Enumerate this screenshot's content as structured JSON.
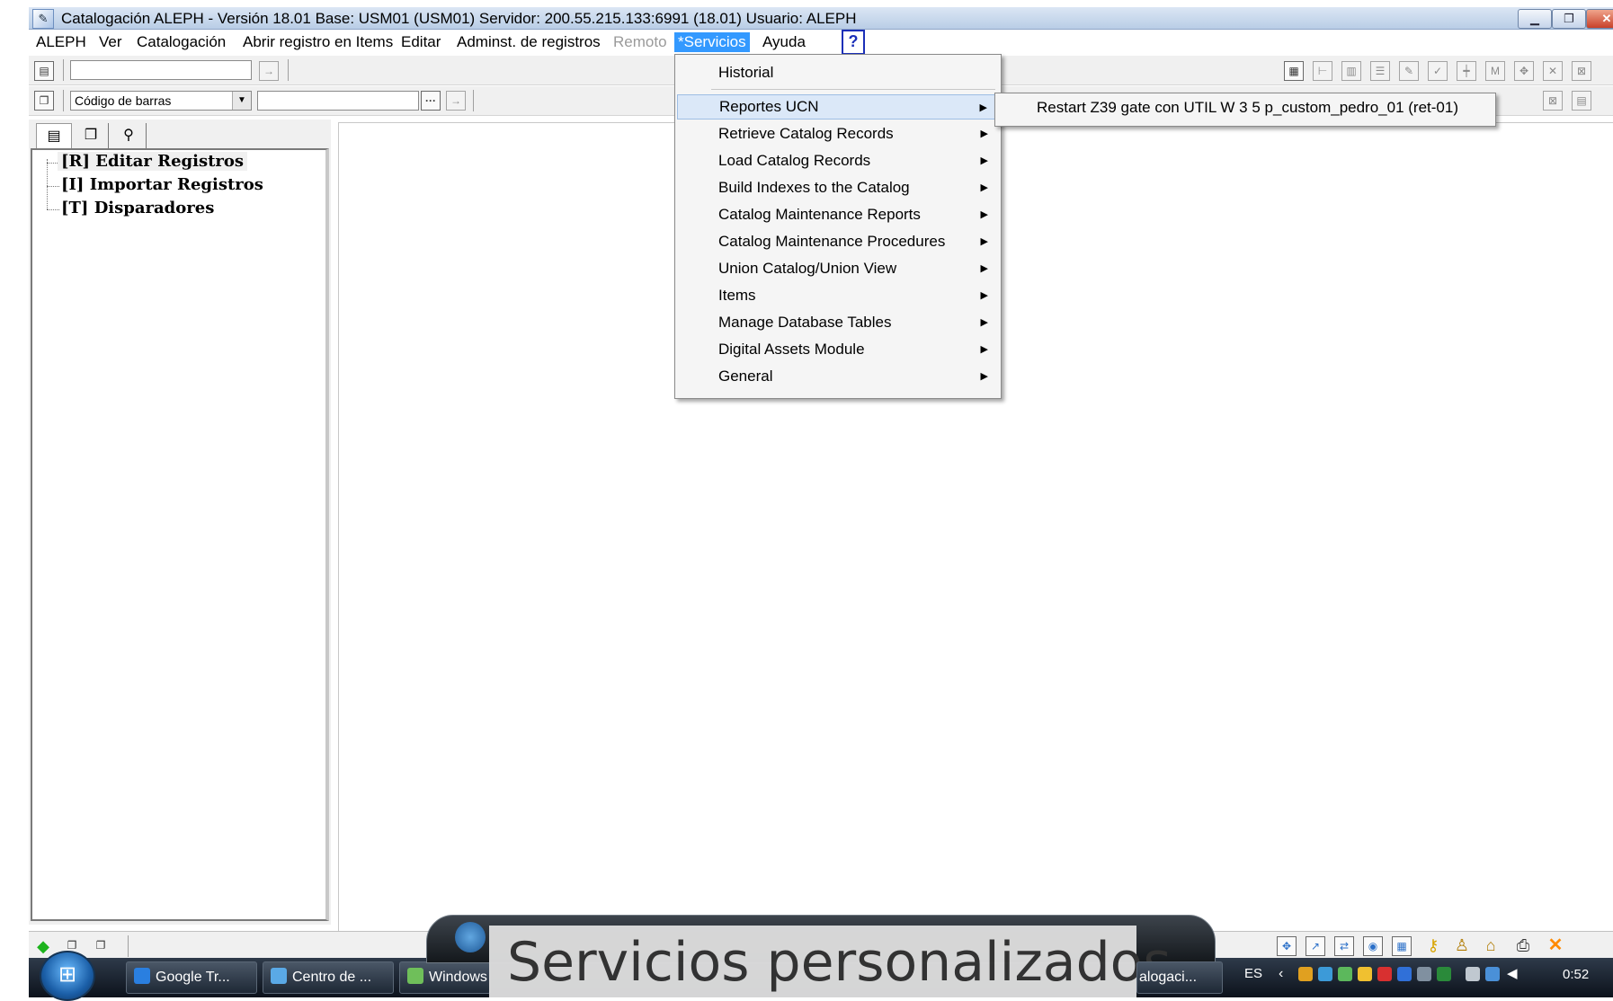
{
  "window": {
    "title": "Catalogación ALEPH - Versión 18.01  Base:  USM01 (USM01)  Servidor:  200.55.215.133:6991 (18.01)  Usuario:  ALEPH"
  },
  "menubar": {
    "items": [
      "ALEPH",
      "Ver",
      "Catalogación",
      "Abrir registro en Items",
      "Editar",
      "Adminst. de registros",
      "Remoto",
      "*Servicios",
      "Ayuda"
    ],
    "help_icon": "?",
    "active_item": "*Servicios",
    "disabled_item": "Remoto"
  },
  "toolbar2": {
    "select_value": "Código de barras",
    "browse_button": "···"
  },
  "tree": {
    "items": [
      "[R] Editar Registros",
      "[I] Importar Registros",
      "[T] Disparadores"
    ]
  },
  "services_menu": {
    "first_item": "Historial",
    "items": [
      "Reportes UCN",
      "Retrieve Catalog Records",
      "Load Catalog Records",
      "Build Indexes to the Catalog",
      "Catalog Maintenance Reports",
      "Catalog Maintenance Procedures",
      "Union Catalog/Union View",
      "Items",
      "Manage Database Tables",
      "Digital Assets Module",
      "General"
    ],
    "highlighted": "Reportes UCN"
  },
  "submenu": {
    "items": [
      "Restart Z39 gate con UTIL W 3 5 p_custom_pedro_01 (ret-01)"
    ]
  },
  "taskbar": {
    "buttons": [
      "Google Tr...",
      "Centro de ...",
      "Windows",
      "alogaci..."
    ],
    "language": "ES",
    "clock": "0:52"
  },
  "caption": {
    "text": "Servicios personalizados"
  },
  "colors": {
    "menu_highlight": "#3399ff",
    "help_icon": "#1b2fb8",
    "titlebar": "#c9d9ee",
    "taskbar": "#1a2430"
  },
  "icons": {
    "app": "catalog-app-icon",
    "toolbar1": [
      "record-icon",
      "go-arrow-icon"
    ],
    "toolbar2": [
      "copy-icon",
      "go-arrow-icon"
    ],
    "right_tools": [
      "edit-record-icon",
      "tree-icon",
      "columns-icon",
      "list-icon",
      "script-icon",
      "check-icon",
      "stamp-icon",
      "m-icon",
      "expand-icon",
      "close-x-icon",
      "close-box-icon"
    ],
    "status_left": [
      "green-diamond-icon",
      "copy-icon",
      "copy-icon"
    ],
    "status_right": [
      "move-icon",
      "chart-icon",
      "swap-icon",
      "globe-icon",
      "table-icon",
      "key-icon",
      "person-icon",
      "home-icon",
      "printer-icon",
      "close-x-icon"
    ]
  }
}
